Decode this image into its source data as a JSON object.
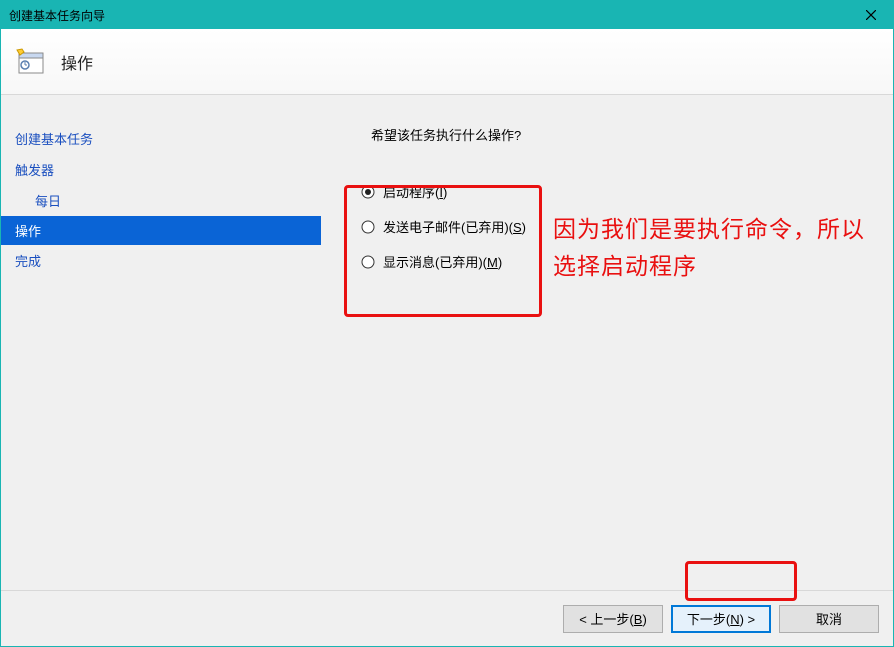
{
  "titlebar": {
    "title": "创建基本任务向导"
  },
  "header": {
    "label": "操作"
  },
  "sidebar": {
    "items": [
      {
        "label": "创建基本任务",
        "indent": false
      },
      {
        "label": "触发器",
        "indent": false
      },
      {
        "label": "每日",
        "indent": true
      },
      {
        "label": "操作",
        "indent": false,
        "selected": true
      },
      {
        "label": "完成",
        "indent": false
      }
    ]
  },
  "main": {
    "question": "希望该任务执行什么操作?",
    "options": [
      {
        "text": "启动程序(",
        "hotkey": "I",
        "tail": ")",
        "checked": true
      },
      {
        "text": "发送电子邮件(已弃用)(",
        "hotkey": "S",
        "tail": ")",
        "checked": false
      },
      {
        "text": "显示消息(已弃用)(",
        "hotkey": "M",
        "tail": ")",
        "checked": false
      }
    ]
  },
  "annotation": "因为我们是要执行命令，所以选择启动程序",
  "footer": {
    "back_pre": "< 上一步(",
    "back_hot": "B",
    "back_tail": ")",
    "next_pre": "下一步(",
    "next_hot": "N",
    "next_tail": ") >",
    "cancel": "取消"
  }
}
